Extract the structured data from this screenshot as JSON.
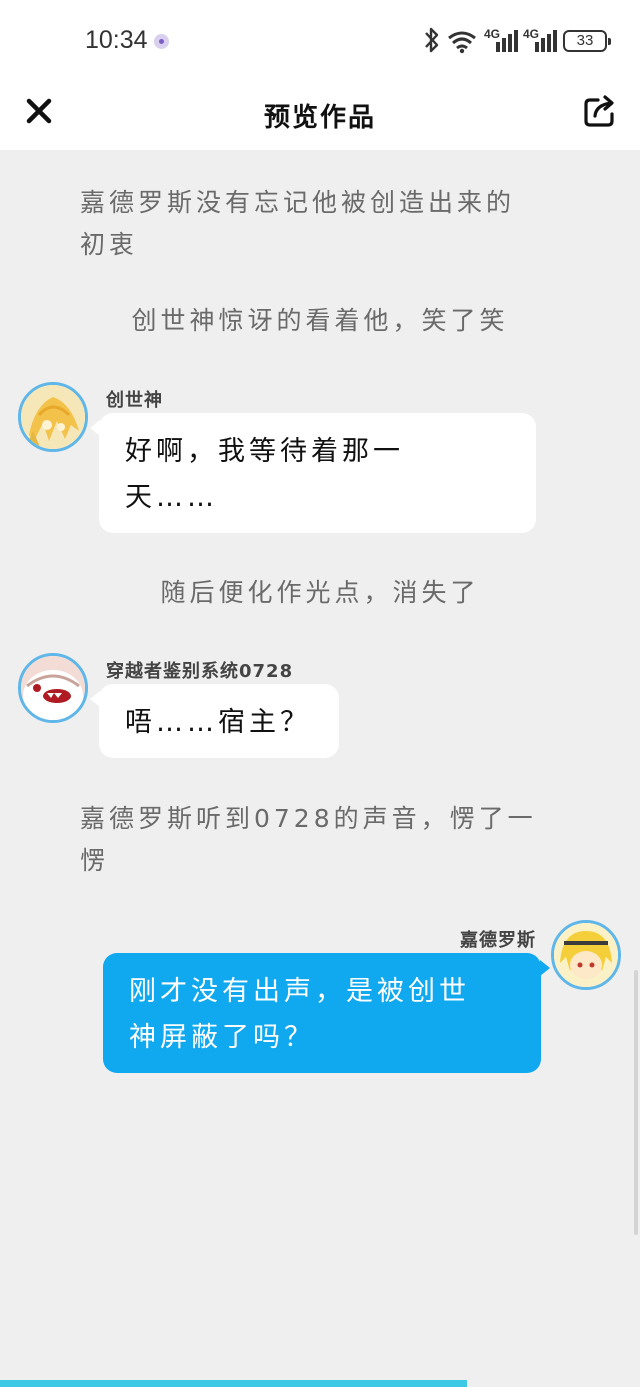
{
  "status_bar": {
    "time": "10:34",
    "network_labels": [
      "4G",
      "4G"
    ],
    "battery": "33"
  },
  "nav": {
    "title": "预览作品",
    "close_icon": "close-icon",
    "share_icon": "share-icon"
  },
  "messages": [
    {
      "type": "narration",
      "lines": [
        "嘉德罗斯没有忘记他被创造出来的",
        "初衷"
      ]
    },
    {
      "type": "narration",
      "text": "创世神惊讶的看着他，笑了笑"
    },
    {
      "type": "chat",
      "side": "left",
      "speaker": "创世神",
      "lines": [
        "好啊，我等待着那一",
        "天……"
      ],
      "avatar_icon": "golden-haired-character-avatar"
    },
    {
      "type": "narration",
      "text": "随后便化作光点，消失了"
    },
    {
      "type": "chat",
      "side": "left",
      "speaker": "穿越者鉴别系统0728",
      "lines": [
        "唔……宿主？"
      ],
      "avatar_icon": "white-creature-avatar"
    },
    {
      "type": "narration",
      "lines": [
        "嘉德罗斯听到0728的声音，愣了一",
        "愣"
      ]
    },
    {
      "type": "chat",
      "side": "right",
      "speaker": "嘉德罗斯",
      "lines": [
        "刚才没有出声，是被创世",
        "神屏蔽了吗？"
      ],
      "avatar_icon": "blonde-character-avatar"
    }
  ],
  "colors": {
    "accent": "#10a8ee",
    "avatar_ring": "#5fb6e8",
    "progress": "#3dc9e6",
    "background": "#efefef"
  },
  "reading_progress": 0.73
}
